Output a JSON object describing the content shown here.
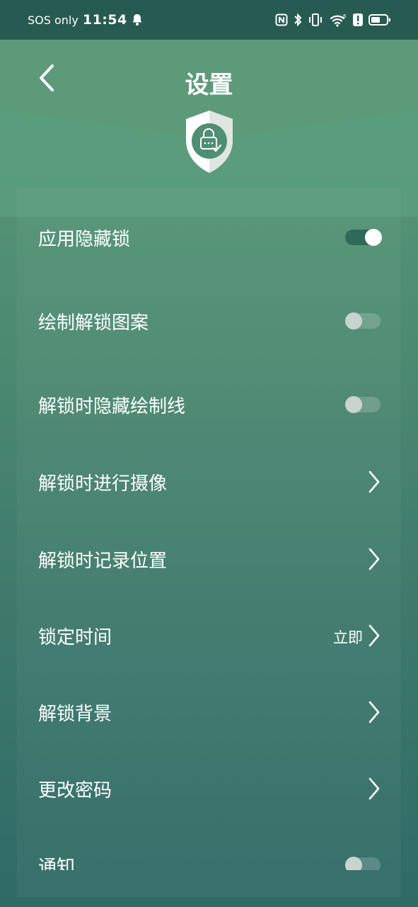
{
  "status_bar": {
    "carrier": "SOS only",
    "time": "11:54",
    "icons": [
      "bell-icon",
      "nfc-icon",
      "bluetooth-icon",
      "vibrate-icon",
      "wifi-icon",
      "alert-icon",
      "battery-icon"
    ],
    "wifi_label": "6"
  },
  "header": {
    "title": "设置",
    "back_icon": "chevron-left-icon",
    "emblem_icon": "shield-lock-icon"
  },
  "settings": [
    {
      "label": "应用隐藏锁",
      "control": "toggle",
      "on": true
    },
    {
      "label": "绘制解锁图案",
      "control": "toggle",
      "on": false
    },
    {
      "label": "解锁时隐藏绘制线",
      "control": "toggle",
      "on": false
    },
    {
      "label": "解锁时进行摄像",
      "control": "chevron"
    },
    {
      "label": "解锁时记录位置",
      "control": "chevron"
    },
    {
      "label": "锁定时间",
      "control": "chevron",
      "value": "立即"
    },
    {
      "label": "解锁背景",
      "control": "chevron"
    },
    {
      "label": "更改密码",
      "control": "chevron"
    },
    {
      "label": "通知",
      "control": "toggle",
      "on": false
    }
  ],
  "colors": {
    "status_bar_bg": "#275a50",
    "bg_top": "#5a9e78",
    "bg_bottom": "#2f6a66",
    "toggle_on_track": "#2f6a58",
    "toggle_knob_on": "#ffffff"
  }
}
